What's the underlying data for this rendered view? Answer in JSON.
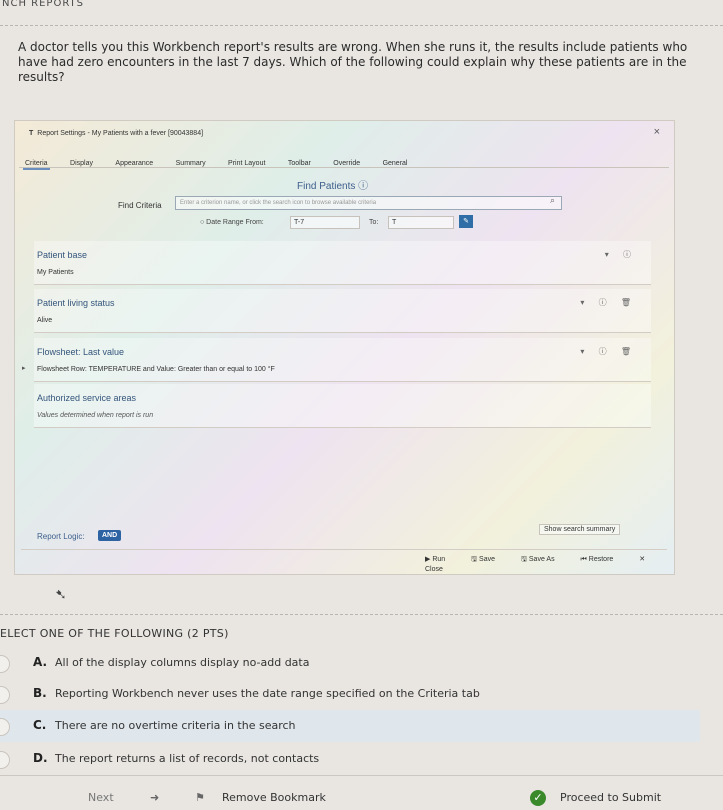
{
  "header": {
    "title": "NCH REPORTS"
  },
  "question": {
    "text": "A doctor tells you this Workbench report's results are wrong. When she runs it, the results include patients who have had zero encounters in the last 7 days. Which of the following could explain why these patients are in the results?"
  },
  "screenshot": {
    "title": "Report Settings - My Patients with a fever [90043884]",
    "tabs": [
      "Criteria",
      "Display",
      "Appearance",
      "Summary",
      "Print Layout",
      "Toolbar",
      "Override",
      "General"
    ],
    "find_patients_title": "Find Patients ⓘ",
    "find_criteria_label": "Find Criteria",
    "find_criteria_placeholder": "Enter a criterion name, or click the search icon to browse available criteria",
    "date_range_label": "○ Date Range  From:",
    "date_from": "T-7",
    "date_to_label": "To:",
    "date_to": "T",
    "cards": [
      {
        "title": "Patient base",
        "value": "My Patients"
      },
      {
        "title": "Patient living status",
        "value": "Alive"
      },
      {
        "title": "Flowsheet: Last value",
        "value": "Flowsheet Row: TEMPERATURE and Value: Greater than or equal to 100 °F"
      },
      {
        "title": "Authorized service areas",
        "value": "Values determined when report is run"
      }
    ],
    "report_logic_label": "Report Logic:",
    "report_logic_value": "AND",
    "show_summary": "Show search summary",
    "actions": [
      "Run",
      "Save",
      "Save As",
      "Restore",
      "Close"
    ]
  },
  "prompt": {
    "select_label": "ELECT ONE OF THE FOLLOWING (2 PTS)"
  },
  "answers": [
    {
      "letter": "A.",
      "text": "All of the display columns display no-add data",
      "selected": false
    },
    {
      "letter": "B.",
      "text": "Reporting Workbench never uses the date range specified on the Criteria tab",
      "selected": false
    },
    {
      "letter": "C.",
      "text": "There are no overtime criteria in the search",
      "selected": true
    },
    {
      "letter": "D.",
      "text": "The report returns a list of records, not contacts",
      "selected": false
    }
  ],
  "footer": {
    "next_label": "Next",
    "remove_bookmark": "Remove Bookmark",
    "proceed": "Proceed to Submit"
  }
}
